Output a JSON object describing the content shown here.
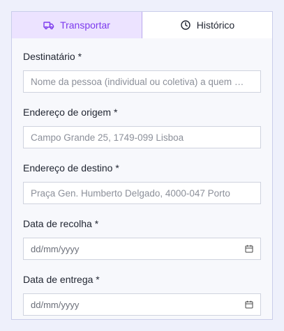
{
  "tabs": [
    {
      "label": "Transportar",
      "icon": "truck-icon",
      "active": true
    },
    {
      "label": "Histórico",
      "icon": "clock-icon",
      "active": false
    }
  ],
  "form": {
    "recipient": {
      "label": "Destinatário *",
      "placeholder": "Nome da pessoa (individual ou coletiva) a quem …"
    },
    "origin": {
      "label": "Endereço de origem *",
      "placeholder": "Campo Grande 25, 1749-099 Lisboa"
    },
    "destination": {
      "label": "Endereço de destino *",
      "placeholder": "Praça Gen. Humberto Delgado, 4000-047 Porto"
    },
    "pickup_date": {
      "label": "Data de recolha *",
      "placeholder": "dd/mm/yyyy",
      "icon": "calendar-icon"
    },
    "delivery_date": {
      "label": "Data de entrega *",
      "placeholder": "dd/mm/yyyy",
      "icon": "calendar-icon"
    }
  },
  "colors": {
    "accent": "#7c3aed",
    "active_tab_bg": "#ece3ff",
    "page_bg": "#eef0fb",
    "panel_bg": "#f7f8fc",
    "border": "#c9cdea"
  }
}
